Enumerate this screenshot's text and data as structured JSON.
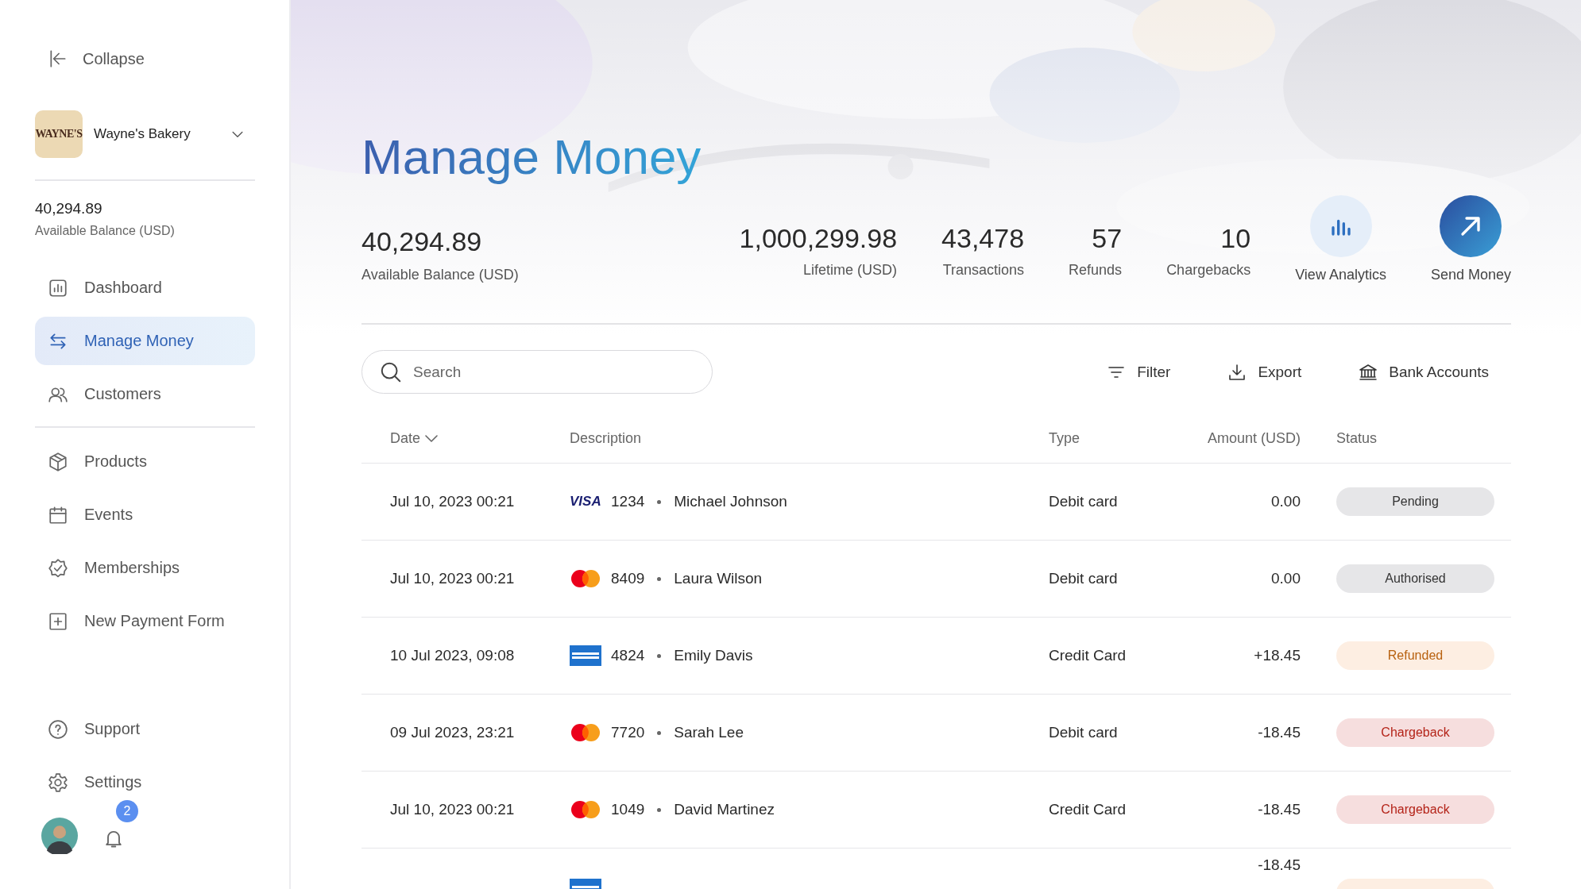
{
  "sidebar": {
    "collapse": {
      "label": "Collapse"
    },
    "business": {
      "name": "Wayne's Bakery",
      "logo_text": "WAYNE'S"
    },
    "balance": {
      "value": "40,294.89",
      "label": "Available Balance (USD)"
    },
    "nav_groups": [
      [
        {
          "label": "Dashboard",
          "selected": false
        },
        {
          "label": "Manage Money",
          "selected": true
        },
        {
          "label": "Customers",
          "selected": false
        }
      ],
      [
        {
          "label": "Products",
          "selected": false
        },
        {
          "label": "Events",
          "selected": false
        },
        {
          "label": "Memberships",
          "selected": false
        },
        {
          "label": "New Payment Form",
          "selected": false
        }
      ]
    ],
    "footer_items": [
      {
        "label": "Support",
        "selected": false
      },
      {
        "label": "Settings",
        "selected": false
      }
    ],
    "notifications": {
      "count": "2"
    }
  },
  "header": {
    "title": "Manage Money",
    "balance": {
      "value": "40,294.89",
      "label": "Available Balance (USD)"
    },
    "stats": [
      {
        "value": "1,000,299.98",
        "label": "Lifetime (USD)"
      },
      {
        "value": "43,478",
        "label": "Transactions"
      },
      {
        "value": "57",
        "label": "Refunds"
      },
      {
        "value": "10",
        "label": "Chargebacks"
      }
    ],
    "actions": [
      {
        "label": "View Analytics",
        "kind": "analytics"
      },
      {
        "label": "Send Money",
        "kind": "send"
      }
    ]
  },
  "toolbar": {
    "search": {
      "placeholder": "Search"
    },
    "actions": [
      {
        "label": "Filter"
      },
      {
        "label": "Export"
      },
      {
        "label": "Bank Accounts"
      }
    ]
  },
  "table": {
    "columns": [
      {
        "label": "Date",
        "sorted": true
      },
      {
        "label": "Description",
        "sorted": false
      },
      {
        "label": "Type",
        "sorted": false
      },
      {
        "label": "Amount (USD)",
        "sorted": false
      },
      {
        "label": "Status",
        "sorted": false
      }
    ],
    "rows": [
      {
        "date": "Jul 10, 2023 00:21",
        "card": {
          "kind": "visa",
          "logo_text": "VISA"
        },
        "last4": "1234",
        "name": "Michael Johnson",
        "type": "Debit card",
        "amount": "0.00",
        "status": {
          "kind": "pending",
          "label": "Pending"
        }
      },
      {
        "date": "Jul 10, 2023 00:21",
        "card": {
          "kind": "mastercard"
        },
        "last4": "8409",
        "name": "Laura Wilson",
        "type": "Debit card",
        "amount": "0.00",
        "status": {
          "kind": "authorised",
          "label": "Authorised"
        }
      },
      {
        "date": "10 Jul 2023, 09:08",
        "card": {
          "kind": "amex"
        },
        "last4": "4824",
        "name": "Emily Davis",
        "type": "Credit Card",
        "amount": "+18.45",
        "status": {
          "kind": "refunded",
          "label": "Refunded"
        }
      },
      {
        "date": "09 Jul 2023, 23:21",
        "card": {
          "kind": "mastercard"
        },
        "last4": "7720",
        "name": "Sarah Lee",
        "type": "Debit card",
        "amount": "-18.45",
        "status": {
          "kind": "chargeback",
          "label": "Chargeback"
        }
      },
      {
        "date": "Jul 10, 2023 00:21",
        "card": {
          "kind": "mastercard"
        },
        "last4": "1049",
        "name": "David Martinez",
        "type": "Credit Card",
        "amount": "-18.45",
        "status": {
          "kind": "chargeback",
          "label": "Chargeback"
        }
      },
      {
        "card": {
          "kind": "amex"
        },
        "amount": "-18.45",
        "status": {
          "kind": "refunded"
        }
      }
    ]
  }
}
